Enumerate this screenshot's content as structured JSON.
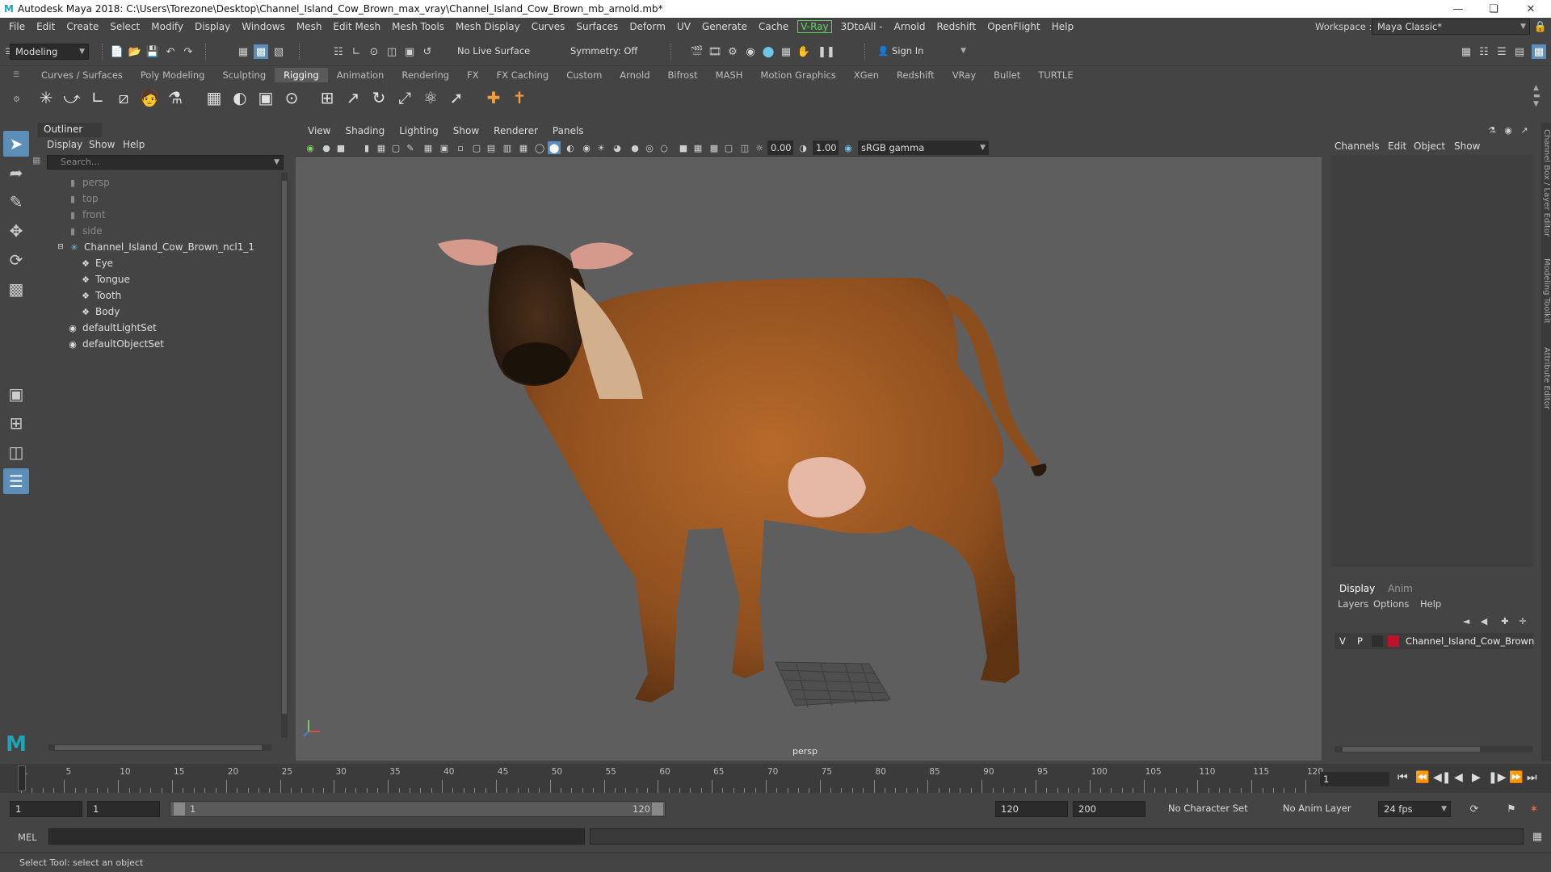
{
  "titlebar": {
    "title": "Autodesk Maya 2018: C:\\Users\\Torezone\\Desktop\\Channel_Island_Cow_Brown_max_vray\\Channel_Island_Cow_Brown_mb_arnold.mb*",
    "logo": "M"
  },
  "menubar": {
    "items": [
      "File",
      "Edit",
      "Create",
      "Select",
      "Modify",
      "Display",
      "Windows",
      "Mesh",
      "Edit Mesh",
      "Mesh Tools",
      "Mesh Display",
      "Curves",
      "Surfaces",
      "Deform",
      "UV",
      "Generate",
      "Cache"
    ],
    "vray": "V-Ray",
    "items2": [
      "3DtoAll -",
      "Arnold",
      "Redshift",
      "OpenFlight",
      "Help"
    ],
    "workspace_label": "Workspace :",
    "workspace_value": "Maya Classic*"
  },
  "statusline": {
    "mode": "Modeling",
    "live_surface": "No Live Surface",
    "symmetry": "Symmetry: Off",
    "sign_in": "Sign In"
  },
  "shelf": {
    "tabs": [
      "Curves / Surfaces",
      "Poly Modeling",
      "Sculpting",
      "Rigging",
      "Animation",
      "Rendering",
      "FX",
      "FX Caching",
      "Custom",
      "Arnold",
      "Bifrost",
      "MASH",
      "Motion Graphics",
      "XGen",
      "Redshift",
      "VRay",
      "Bullet",
      "TURTLE"
    ],
    "active": "Rigging"
  },
  "outliner": {
    "title": "Outliner",
    "menus": [
      "Display",
      "Show",
      "Help"
    ],
    "search_placeholder": "Search...",
    "items": [
      {
        "label": "persp",
        "type": "camera"
      },
      {
        "label": "top",
        "type": "camera"
      },
      {
        "label": "front",
        "type": "camera"
      },
      {
        "label": "side",
        "type": "camera"
      },
      {
        "label": "Channel_Island_Cow_Brown_ncl1_1",
        "type": "group"
      },
      {
        "label": "Eye",
        "type": "mesh"
      },
      {
        "label": "Tongue",
        "type": "mesh"
      },
      {
        "label": "Tooth",
        "type": "mesh"
      },
      {
        "label": "Body",
        "type": "mesh"
      },
      {
        "label": "defaultLightSet",
        "type": "set"
      },
      {
        "label": "defaultObjectSet",
        "type": "set"
      }
    ]
  },
  "viewport": {
    "menus": [
      "View",
      "Shading",
      "Lighting",
      "Show",
      "Renderer",
      "Panels"
    ],
    "exposure": "0.00",
    "gamma": "1.00",
    "colorspace": "sRGB gamma",
    "camera_label": "persp"
  },
  "channelbox": {
    "menus": [
      "Channels",
      "Edit",
      "Object",
      "Show"
    ],
    "side_tabs": [
      "Channel Box / Layer Editor",
      "Modeling Toolkit",
      "Attribute Editor"
    ]
  },
  "layers": {
    "tabs": [
      "Display",
      "Anim"
    ],
    "menus": [
      "Layers",
      "Options",
      "Help"
    ],
    "row": {
      "v": "V",
      "p": "P",
      "name": "Channel_Island_Cow_Brown",
      "color": "#c0102a"
    }
  },
  "timeline": {
    "labels": [
      "1",
      "5",
      "10",
      "15",
      "20",
      "25",
      "30",
      "35",
      "40",
      "45",
      "50",
      "55",
      "60",
      "65",
      "70",
      "75",
      "80",
      "85",
      "90",
      "95",
      "100",
      "105",
      "110",
      "115",
      "120"
    ],
    "current_frame": "1"
  },
  "range": {
    "start": "1",
    "playback_start": "1",
    "slider_start": "1",
    "slider_end": "120",
    "playback_end": "120",
    "end": "200",
    "character_set": "No Character Set",
    "anim_layer": "No Anim Layer",
    "fps": "24 fps"
  },
  "mel": {
    "label": "MEL"
  },
  "helpline": {
    "text": "Select Tool: select an object"
  }
}
